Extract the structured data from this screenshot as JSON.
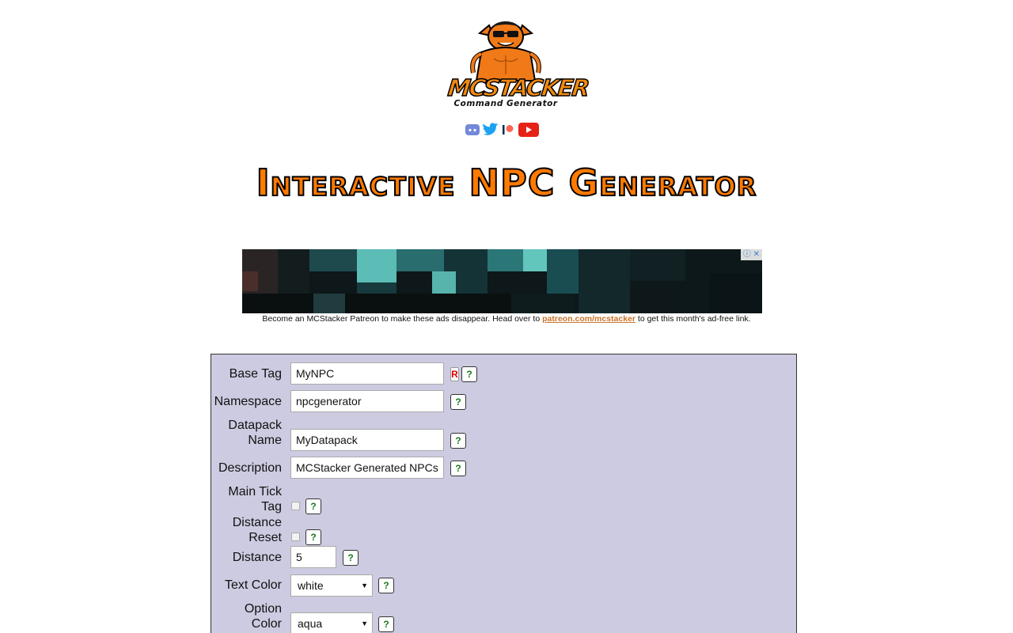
{
  "logo": {
    "wordmark": "MCSTACKER",
    "subtitle": "Command Generator"
  },
  "social_icons": [
    "discord-icon",
    "twitter-icon",
    "patreon-icon",
    "youtube-icon"
  ],
  "heading": "Interactive NPC Generator",
  "ad": {
    "note_before": "Become an MCStacker Patreon to make these ads disappear. Head over to ",
    "note_link": "patreon.com/mcstacker",
    "note_after": " to get this month's ad-free link."
  },
  "form": {
    "base_tag": {
      "label": "Base Tag",
      "value": "MyNPC",
      "required_mark": "R",
      "help": "?"
    },
    "namespace": {
      "label": "Namespace",
      "value": "npcgenerator",
      "help": "?"
    },
    "datapack_name": {
      "label_line1": "Datapack",
      "label_line2": "Name",
      "value": "MyDatapack",
      "help": "?"
    },
    "description": {
      "label": "Description",
      "value": "MCStacker Generated NPCs",
      "help": "?"
    },
    "main_tick_tag": {
      "label_line1": "Main Tick",
      "label_line2": "Tag",
      "checked": false,
      "help": "?"
    },
    "distance_reset": {
      "label_line1": "Distance",
      "label_line2": "Reset",
      "checked": false,
      "help": "?"
    },
    "distance": {
      "label": "Distance",
      "value": "5",
      "help": "?"
    },
    "text_color": {
      "label": "Text Color",
      "value": "white",
      "help": "?"
    },
    "option_color": {
      "label_line1": "Option",
      "label_line2": "Color",
      "value": "aqua",
      "help": "?"
    }
  },
  "colors": {
    "panel_bg": "#cdcbe1",
    "heading_orange": "#ff7a00",
    "help_green": "#1a7a1a",
    "required_red": "#dd0000"
  }
}
